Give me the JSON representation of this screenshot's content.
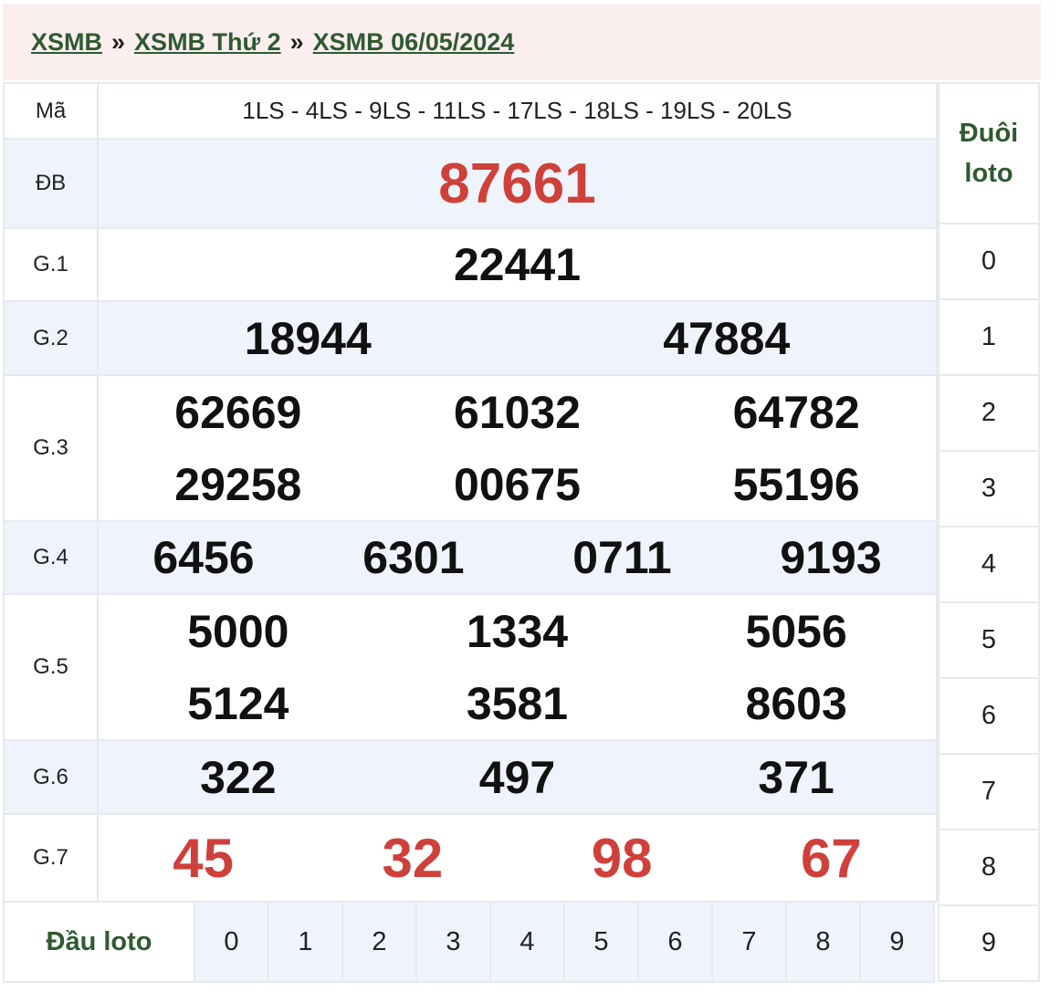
{
  "breadcrumb": {
    "items": [
      "XSMB",
      "XSMB Thứ 2",
      "XSMB 06/05/2024"
    ],
    "separator": "»"
  },
  "result": {
    "ma_label": "Mã",
    "ma_value": "1LS - 4LS - 9LS - 11LS - 17LS - 18LS - 19LS - 20LS",
    "db_label": "ĐB",
    "db_value": "87661",
    "g1_label": "G.1",
    "g1": [
      "22441"
    ],
    "g2_label": "G.2",
    "g2": [
      "18944",
      "47884"
    ],
    "g3_label": "G.3",
    "g3": [
      "62669",
      "61032",
      "64782",
      "29258",
      "00675",
      "55196"
    ],
    "g4_label": "G.4",
    "g4": [
      "6456",
      "6301",
      "0711",
      "9193"
    ],
    "g5_label": "G.5",
    "g5": [
      "5000",
      "1334",
      "5056",
      "5124",
      "3581",
      "8603"
    ],
    "g6_label": "G.6",
    "g6": [
      "322",
      "497",
      "371"
    ],
    "g7_label": "G.7",
    "g7": [
      "45",
      "32",
      "98",
      "67"
    ]
  },
  "duoi_loto": {
    "title_line1": "Đuôi",
    "title_line2": "loto",
    "rows": [
      "0",
      "1",
      "2",
      "3",
      "4",
      "5",
      "6",
      "7",
      "8",
      "9"
    ]
  },
  "dau_loto": {
    "title": "Đầu loto",
    "cols": [
      "0",
      "1",
      "2",
      "3",
      "4",
      "5",
      "6",
      "7",
      "8",
      "9"
    ]
  },
  "colors": {
    "accent_green": "#2f5a30",
    "prize_red": "#d0403a",
    "row_alt": "#eff3fb",
    "breadcrumb_bg": "#fbeeee"
  }
}
